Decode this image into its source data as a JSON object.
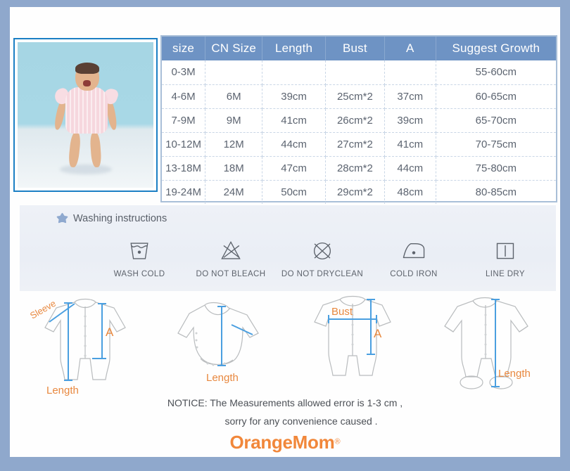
{
  "theme": {
    "frame_color": "#8fa8cc",
    "photo_border": "#1b7fc4",
    "table_header_bg": "#6e93c4",
    "table_border": "#a9bfd8",
    "wash_panel_bg": "#eaeef5",
    "accent_orange": "#f1873a",
    "measure_blue": "#4a9fe0"
  },
  "photo": {
    "alt_name": "baby-wearing-pink-romper"
  },
  "size_table": {
    "columns": [
      "size",
      "CN Size",
      "Length",
      "Bust",
      "A",
      "Suggest Growth"
    ],
    "rows": [
      [
        "0-3M",
        "",
        "",
        "",
        "",
        "55-60cm"
      ],
      [
        "4-6M",
        "6M",
        "39cm",
        "25cm*2",
        "37cm",
        "60-65cm"
      ],
      [
        "7-9M",
        "9M",
        "41cm",
        "26cm*2",
        "39cm",
        "65-70cm"
      ],
      [
        "10-12M",
        "12M",
        "44cm",
        "27cm*2",
        "41cm",
        "70-75cm"
      ],
      [
        "13-18M",
        "18M",
        "47cm",
        "28cm*2",
        "44cm",
        "75-80cm"
      ],
      [
        "19-24M",
        "24M",
        "50cm",
        "29cm*2",
        "48cm",
        "80-85cm"
      ]
    ]
  },
  "washing": {
    "title": "Washing instructions",
    "star_icon": "star-icon",
    "items": [
      {
        "label": "WASH COLD",
        "icon": "wash-cold-icon"
      },
      {
        "label": "DO NOT BLEACH",
        "icon": "do-not-bleach-icon"
      },
      {
        "label": "DO NOT DRYCLEAN",
        "icon": "do-not-dryclean-icon"
      },
      {
        "label": "COLD IRON",
        "icon": "cold-iron-icon"
      },
      {
        "label": "LINE DRY",
        "icon": "line-dry-icon"
      }
    ]
  },
  "diagrams": [
    {
      "name": "long-sleeve-romper-front",
      "labels": {
        "sleeve": "Sleeve",
        "a": "A",
        "length": "Length"
      }
    },
    {
      "name": "long-sleeve-bodysuit",
      "labels": {
        "length": "Length"
      }
    },
    {
      "name": "short-sleeve-romper",
      "labels": {
        "bust": "Bust",
        "a": "A"
      }
    },
    {
      "name": "footed-sleepsuit",
      "labels": {
        "length": "Length"
      }
    }
  ],
  "notice": {
    "line1": "NOTICE:   The Measurements allowed error is 1-3 cm ,",
    "line2": "sorry for any convenience caused ."
  },
  "logo": {
    "text": "OrangeMom",
    "reg": "®",
    "heart": "♥"
  }
}
